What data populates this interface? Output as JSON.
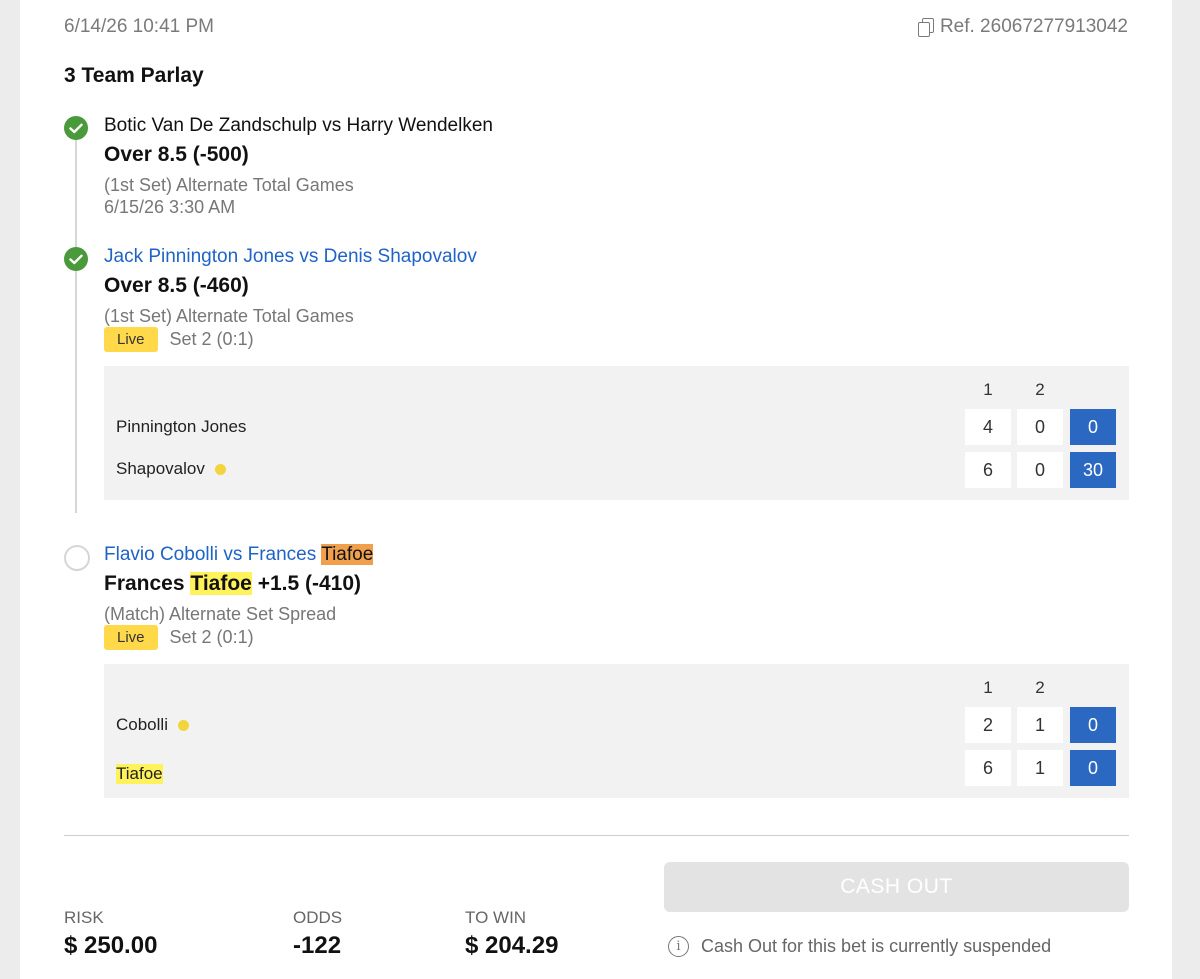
{
  "header": {
    "datetime": "6/14/26 10:41 PM",
    "ref": "Ref. 26067277913042",
    "title": "3 Team Parlay"
  },
  "legs": [
    {
      "status": "won",
      "matchup": "Botic Van De Zandschulp vs Harry Wendelken",
      "pick": "Over 8.5 (-500)",
      "market": "(1st Set) Alternate Total Games",
      "time": "6/15/26 3:30 AM"
    },
    {
      "status": "won",
      "matchup": "Jack Pinnington Jones vs Denis Shapovalov",
      "pick": "Over 8.5 (-460)",
      "market": "(1st Set) Alternate Total Games",
      "live": "Live",
      "set_info": "Set 2 (0:1)",
      "scoreboard": {
        "headers": [
          "1",
          "2"
        ],
        "players": [
          {
            "name": "Pinnington Jones",
            "serving": false,
            "sets": [
              "4",
              "0"
            ],
            "points": "0"
          },
          {
            "name": "Shapovalov",
            "serving": true,
            "sets": [
              "6",
              "0"
            ],
            "points": "30"
          }
        ]
      }
    },
    {
      "status": "pending",
      "matchup_prefix": "Flavio Cobolli vs Frances ",
      "matchup_highlight": "Tiafoe",
      "pick_prefix": "Frances ",
      "pick_highlight": "Tiafoe",
      "pick_suffix": " +1.5 (-410)",
      "market": "(Match) Alternate Set Spread",
      "live": "Live",
      "set_info": "Set 2 (0:1)",
      "scoreboard": {
        "headers": [
          "1",
          "2"
        ],
        "players": [
          {
            "name": "Cobolli",
            "serving": true,
            "sets": [
              "2",
              "1"
            ],
            "points": "0"
          },
          {
            "name": "Tiafoe",
            "serving": false,
            "sets": [
              "6",
              "1"
            ],
            "points": "0"
          }
        ]
      }
    }
  ],
  "summary": {
    "risk_label": "RISK",
    "risk_value": "$ 250.00",
    "odds_label": "ODDS",
    "odds_value": "-122",
    "towin_label": "TO WIN",
    "towin_value": "$ 204.29"
  },
  "cashout": {
    "label": "CASH OUT",
    "notice": "Cash Out for this bet is currently suspended"
  },
  "colors": {
    "won": "#4a9a3b",
    "link": "#1f63c6",
    "live_badge": "#ffd94a",
    "points_cell": "#2a68c1",
    "highlight_orange": "#f0a04c",
    "highlight_yellow": "#fff25a"
  }
}
